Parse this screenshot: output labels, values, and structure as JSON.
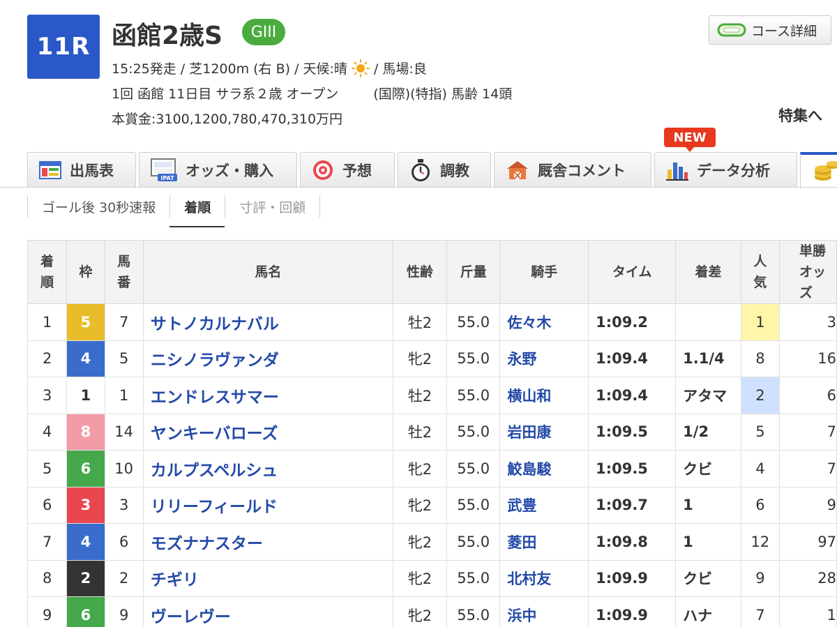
{
  "race": {
    "number": "11R",
    "name": "函館2歳S",
    "grade": "GIII",
    "start": "15:25発走 / 芝1200m (右 B) / 天候:晴",
    "track": "/ 馬場:良",
    "meta_left": "1回 函館 11日目 サラ系２歳 オープン",
    "meta_right": "(国際)(特指) 馬齢 14頭",
    "prize": "本賞金:3100,1200,780,470,310万円",
    "course_detail": "コース詳細",
    "feature": "特集へ"
  },
  "tabs": [
    {
      "label": "出馬表",
      "icon": "entry-table-icon"
    },
    {
      "label": "オッズ・購入",
      "icon": "ipat-icon",
      "icon_text": "IPAT"
    },
    {
      "label": "予想",
      "icon": "target-icon"
    },
    {
      "label": "調教",
      "icon": "stopwatch-icon"
    },
    {
      "label": "厩舎コメント",
      "icon": "stable-icon"
    },
    {
      "label": "データ分析",
      "icon": "bar-chart-icon",
      "badge": "NEW"
    },
    {
      "label": "",
      "icon": "coins-icon"
    }
  ],
  "subtabs": {
    "flash": "ゴール後 30秒速報",
    "order": "着順",
    "comment": "寸評・回顧"
  },
  "table": {
    "headers": {
      "rank": "着順",
      "waku": "枠",
      "num": "馬番",
      "name": "馬名",
      "sexage": "性齢",
      "weight": "斤量",
      "jockey": "騎手",
      "time": "タイム",
      "margin": "着差",
      "pop": "人気",
      "odds": "単勝オッズ"
    },
    "rows": [
      {
        "rank": "1",
        "waku": "5",
        "num": "7",
        "name": "サトノカルナバル",
        "sexage": "牡2",
        "weight": "55.0",
        "jockey": "佐々木",
        "time": "1:09.2",
        "margin": "",
        "pop": "1",
        "odds": "3"
      },
      {
        "rank": "2",
        "waku": "4",
        "num": "5",
        "name": "ニシノラヴァンダ",
        "sexage": "牝2",
        "weight": "55.0",
        "jockey": "永野",
        "time": "1:09.4",
        "margin": "1.1/4",
        "pop": "8",
        "odds": "16"
      },
      {
        "rank": "3",
        "waku": "1",
        "num": "1",
        "name": "エンドレスサマー",
        "sexage": "牡2",
        "weight": "55.0",
        "jockey": "横山和",
        "time": "1:09.4",
        "margin": "アタマ",
        "pop": "2",
        "odds": "6"
      },
      {
        "rank": "4",
        "waku": "8",
        "num": "14",
        "name": "ヤンキーバローズ",
        "sexage": "牡2",
        "weight": "55.0",
        "jockey": "岩田康",
        "time": "1:09.5",
        "margin": "1/2",
        "pop": "5",
        "odds": "7"
      },
      {
        "rank": "5",
        "waku": "6",
        "num": "10",
        "name": "カルプスペルシュ",
        "sexage": "牝2",
        "weight": "55.0",
        "jockey": "鮫島駿",
        "time": "1:09.5",
        "margin": "クビ",
        "pop": "4",
        "odds": "7"
      },
      {
        "rank": "6",
        "waku": "3",
        "num": "3",
        "name": "リリーフィールド",
        "sexage": "牝2",
        "weight": "55.0",
        "jockey": "武豊",
        "time": "1:09.7",
        "margin": "1",
        "pop": "6",
        "odds": "9"
      },
      {
        "rank": "7",
        "waku": "4",
        "num": "6",
        "name": "モズナナスター",
        "sexage": "牝2",
        "weight": "55.0",
        "jockey": "菱田",
        "time": "1:09.8",
        "margin": "1",
        "pop": "12",
        "odds": "97"
      },
      {
        "rank": "8",
        "waku": "2",
        "num": "2",
        "name": "チギリ",
        "sexage": "牝2",
        "weight": "55.0",
        "jockey": "北村友",
        "time": "1:09.9",
        "margin": "クビ",
        "pop": "9",
        "odds": "28"
      },
      {
        "rank": "9",
        "waku": "6",
        "num": "9",
        "name": "ヴーレヴー",
        "sexage": "牝2",
        "weight": "55.0",
        "jockey": "浜中",
        "time": "1:09.9",
        "margin": "ハナ",
        "pop": "7",
        "odds": "1"
      }
    ]
  },
  "colors": {
    "race_badge": "#2b58c8",
    "grade": "#4aac3e",
    "new_badge": "#e6391e",
    "link": "#2349a8",
    "waku": {
      "1": "#ffffff",
      "2": "#333333",
      "3": "#e8474f",
      "4": "#3a6ccb",
      "5": "#e9bd2a",
      "6": "#45a84a",
      "7": "#f08a2e",
      "8": "#f29ca8"
    }
  }
}
